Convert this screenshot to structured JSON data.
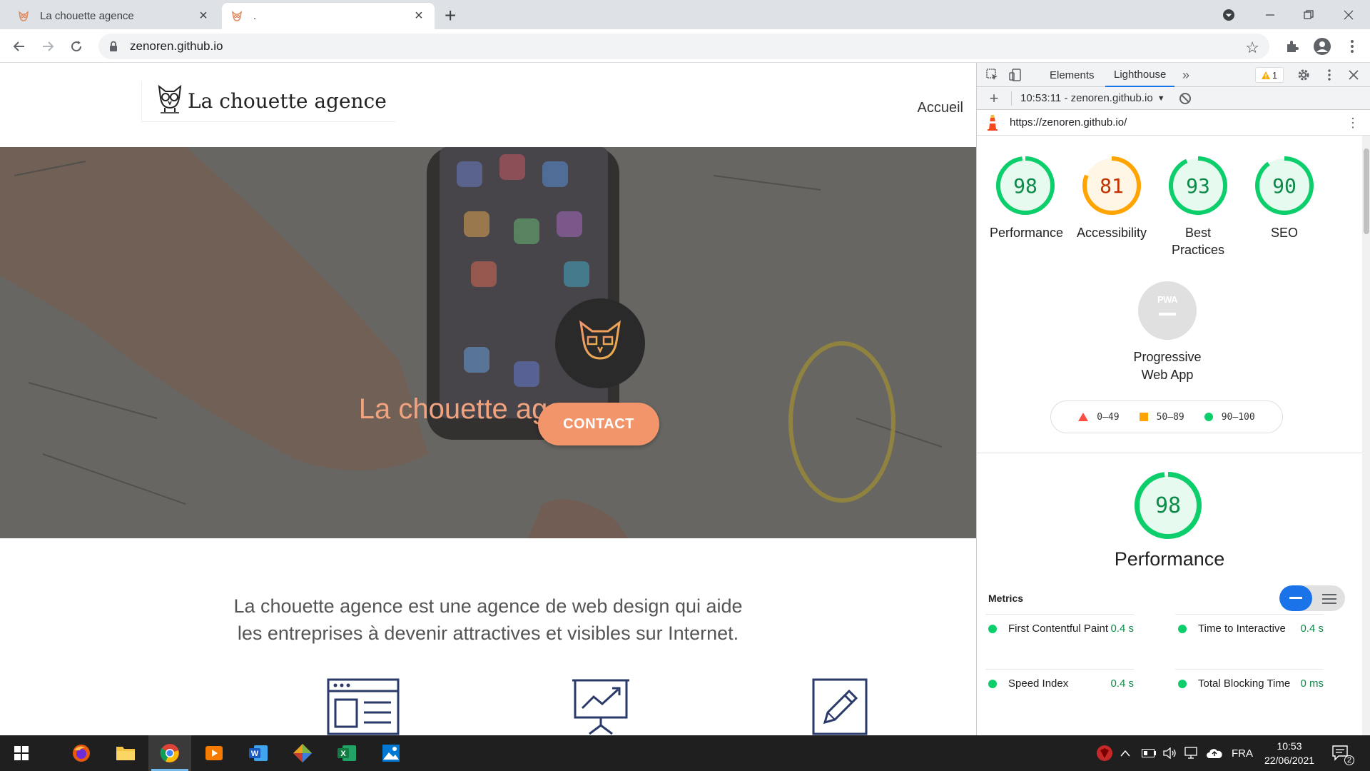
{
  "browser": {
    "tabs": [
      {
        "title": "La chouette agence",
        "close": "×"
      },
      {
        "title": ".",
        "close": "×"
      }
    ],
    "new_tab": "+",
    "url": "zenoren.github.io"
  },
  "site": {
    "brand": "La chouette agence",
    "nav": [
      "Accueil"
    ],
    "hero_title": "La chouette agence.",
    "cta": "CONTACT",
    "intro_lines": [
      "La chouette agence est une agence de web design qui aide",
      "les entreprises à devenir attractives et visibles sur Internet."
    ]
  },
  "devtools": {
    "tabs": [
      "Elements",
      "Lighthouse"
    ],
    "more": "»",
    "warning_count": "1",
    "report_time": "10:53:11 - zenoren.github.io",
    "dropdown_arrow": "▼",
    "audited_url": "https://zenoren.github.io/",
    "scores": [
      {
        "label": "Performance",
        "value": 98,
        "color": "#0cce6b",
        "text_color": "#0c8a48"
      },
      {
        "label": "Accessibility",
        "value": 81,
        "color": "#ffa400",
        "text_color": "#c33300"
      },
      {
        "label": "Best Practices",
        "value": 93,
        "color": "#0cce6b",
        "text_color": "#0c8a48"
      },
      {
        "label": "SEO",
        "value": 90,
        "color": "#0cce6b",
        "text_color": "#0c8a48"
      }
    ],
    "pwa": {
      "badge": "PWA",
      "label": "Progressive Web App"
    },
    "legend": [
      {
        "range": "0–49",
        "shape": "triangle",
        "color": "#ff4e42"
      },
      {
        "range": "50–89",
        "shape": "square",
        "color": "#ffa400"
      },
      {
        "range": "90–100",
        "shape": "circle",
        "color": "#0cce6b"
      }
    ],
    "performance": {
      "value": 98,
      "title": "Performance"
    },
    "metrics_label": "Metrics",
    "metrics": [
      {
        "name": "First Contentful Paint",
        "value": "0.4 s"
      },
      {
        "name": "Time to Interactive",
        "value": "0.4 s"
      },
      {
        "name": "Speed Index",
        "value": "0.4 s"
      },
      {
        "name": "Total Blocking Time",
        "value": "0 ms"
      }
    ]
  },
  "taskbar": {
    "language": "FRA",
    "time": "10:53",
    "date": "22/06/2021",
    "notifications": "2"
  }
}
